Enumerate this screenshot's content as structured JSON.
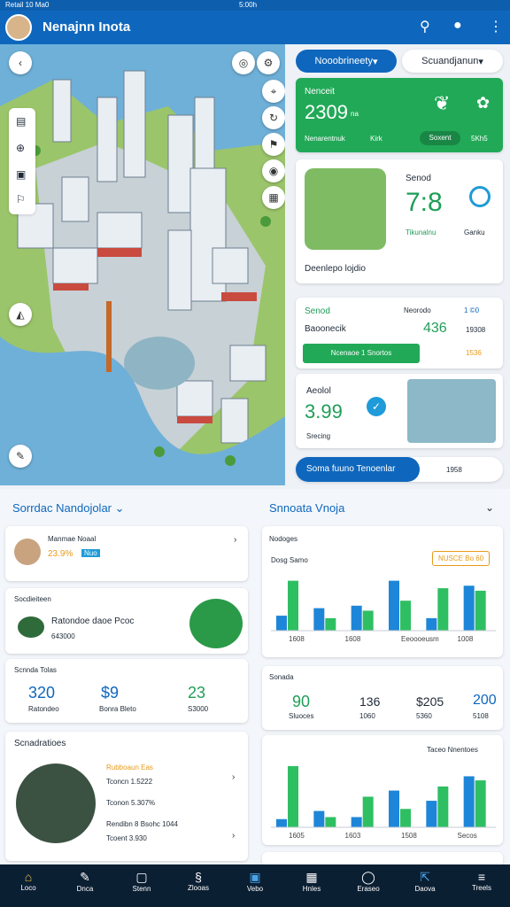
{
  "status": {
    "left": "Retail 10 Ma0",
    "center": "5:00h"
  },
  "header": {
    "title": "Nenajnn Inota"
  },
  "toolbar": {
    "pill_left": "Nooobrineety",
    "pill_right": "Scuandjanun"
  },
  "card1": {
    "title": "Nenceit",
    "value": "2309",
    "unit": "na",
    "l1": "Nenarentnuk",
    "l2": "Kirk",
    "l3": "Soxent",
    "l4": "5Kh5"
  },
  "card2": {
    "title": "Senod",
    "value": "7:8",
    "r1": "Tikunalnu",
    "r2": "Ganku",
    "foot": "Deenlepo lojdio"
  },
  "card3": {
    "title": "Senod",
    "sub": "Baoonecik",
    "r1": "Neorodo",
    "v1": "1 ©0",
    "v2": "436",
    "v3": "19308",
    "btn": "Ncenaoe 1 Snortos",
    "v4": "1536"
  },
  "card4": {
    "title": "Aeolol",
    "value": "3.99",
    "foot": "Srecing"
  },
  "bar_search": {
    "label": "Soma fuuno Tenoenlar",
    "value": "1958"
  },
  "left_section": {
    "title": "Sorrdac Nandojolar",
    "r1_name": "Manmae Noaal",
    "r1_val": "23.9%",
    "r1_badge": "Nuo",
    "r2_head": "Socdieiteen",
    "r2_name": "Ratondoe daoe Pcoc",
    "r2_sub": "643000",
    "r3_head": "Scnnda Tolas",
    "vals": [
      "320",
      "$9",
      "23"
    ],
    "subs": [
      "Ratondeo",
      "Bonra Bleto",
      "S3000"
    ],
    "r4_head": "Scnadratioes",
    "list": [
      {
        "a": "Rubboaun Eas",
        "b": "Tconcn 1.5222"
      },
      {
        "a": "Tconon 5.307%",
        "b": ""
      },
      {
        "a": "Rendibn 8 Bsohc 1044",
        "b": "Tcoent 3.930"
      }
    ]
  },
  "right_section": {
    "title": "Snnoata Vnoja",
    "label1": "Nodoges",
    "label2": "Dosg Samo",
    "btn": "NUSCE Bo 60",
    "label3": "Sonada",
    "s1": "90",
    "s2": "136",
    "s3": "$205",
    "s4": "200",
    "ft": [
      "Sluoces",
      "1060",
      "5360",
      "5108"
    ],
    "label4": "Taceo Nnentoes"
  },
  "chart_data": [
    {
      "type": "bar",
      "categories": [
        "A",
        "B",
        "C",
        "D",
        "E",
        "F"
      ],
      "series": [
        {
          "values": [
            6,
            9,
            10,
            20,
            5,
            18
          ]
        },
        {
          "values": [
            20,
            5,
            8,
            12,
            17,
            16
          ]
        }
      ],
      "xlabels": [
        "1608",
        "1608",
        "Eeoooeusm",
        "1008"
      ]
    },
    {
      "type": "bar",
      "categories": [
        "A",
        "B",
        "C",
        "D",
        "E",
        "F"
      ],
      "series": [
        {
          "values": [
            4,
            8,
            5,
            18,
            13,
            25
          ]
        },
        {
          "values": [
            30,
            5,
            15,
            9,
            20,
            23
          ]
        }
      ],
      "xlabels": [
        "1605",
        "1603",
        "1508",
        "Secos"
      ]
    }
  ],
  "nav": [
    "Loco",
    "Dnca",
    "Stenn",
    "Zlooas",
    "Vebo",
    "Hnles",
    "Eraseo",
    "Daova",
    "Treels"
  ]
}
